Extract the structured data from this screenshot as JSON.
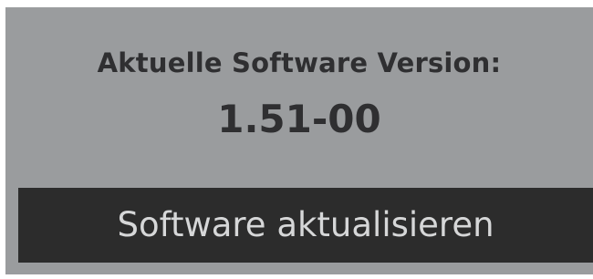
{
  "software": {
    "version_label": "Aktuelle Software Version:",
    "version_value": "1.51-00",
    "update_button_label": "Software aktualisieren"
  },
  "colors": {
    "panel_background": "#9a9c9e",
    "text_dark": "#2f2f31",
    "button_background": "#2c2c2c",
    "button_text": "#d6d7d8"
  }
}
